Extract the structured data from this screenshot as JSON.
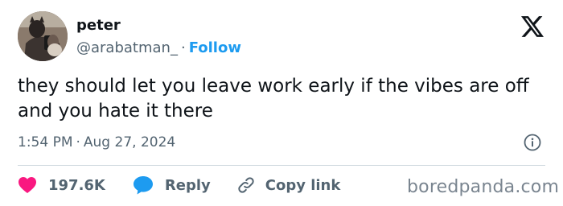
{
  "author": {
    "name": "peter",
    "handle": "@arabatman_",
    "separator": "·",
    "follow_label": "Follow"
  },
  "brand_icon": "x-logo-icon",
  "tweet": {
    "text": "they should let you leave work early if the vibes are off and you hate it there"
  },
  "meta": {
    "time": "1:54 PM",
    "separator": "·",
    "date": "Aug 27, 2024",
    "info_icon": "info-icon"
  },
  "actions": {
    "likes_count": "197.6K",
    "reply_label": "Reply",
    "copy_link_label": "Copy link"
  },
  "watermark": "boredpanda.com",
  "colors": {
    "accent": "#1d9bf0",
    "like": "#f91880",
    "text": "#0f1419",
    "secondary": "#536471"
  }
}
